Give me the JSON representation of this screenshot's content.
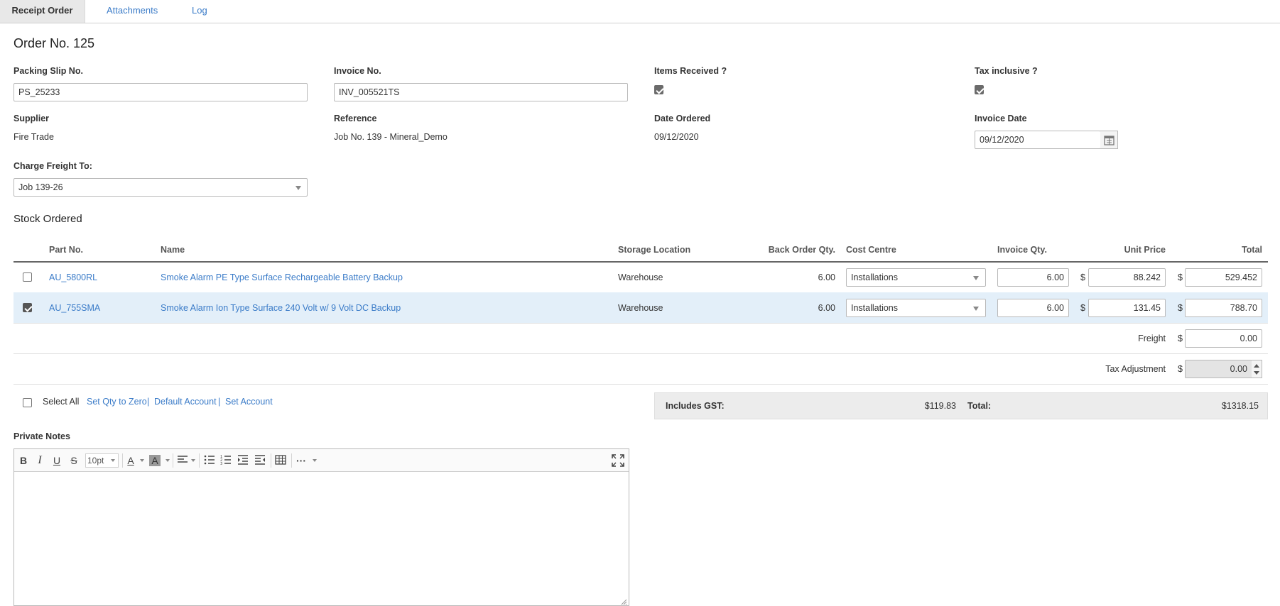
{
  "tabs": [
    {
      "label": "Receipt Order"
    },
    {
      "label": "Attachments"
    },
    {
      "label": "Log"
    }
  ],
  "page_title": "Order No. 125",
  "form": {
    "packing_slip_label": "Packing Slip No.",
    "packing_slip_value": "PS_25233",
    "invoice_no_label": "Invoice No.",
    "invoice_no_value": "INV_005521TS",
    "items_received_label": "Items Received ?",
    "tax_inclusive_label": "Tax inclusive ?",
    "supplier_label": "Supplier",
    "supplier_value": "Fire Trade",
    "reference_label": "Reference",
    "reference_value": "Job No. 139 - Mineral_Demo",
    "date_ordered_label": "Date Ordered",
    "date_ordered_value": "09/12/2020",
    "invoice_date_label": "Invoice Date",
    "invoice_date_value": "09/12/2020",
    "charge_freight_label": "Charge Freight To:",
    "charge_freight_value": "Job 139-26"
  },
  "stock": {
    "title": "Stock Ordered",
    "headers": {
      "part_no": "Part No.",
      "name": "Name",
      "storage": "Storage Location",
      "back_order": "Back Order Qty.",
      "cost_centre": "Cost Centre",
      "invoice_qty": "Invoice Qty.",
      "unit_price": "Unit Price",
      "total": "Total"
    },
    "currency": "$",
    "rows": [
      {
        "part_no": "AU_5800RL",
        "name": "Smoke Alarm PE Type Surface Rechargeable Battery Backup",
        "storage": "Warehouse",
        "back_order": "6.00",
        "cost_centre": "Installations",
        "invoice_qty": "6.00",
        "unit_price": "88.242",
        "total": "529.452",
        "checked": false
      },
      {
        "part_no": "AU_755SMA",
        "name": "Smoke Alarm Ion Type Surface 240 Volt w/ 9 Volt DC Backup",
        "storage": "Warehouse",
        "back_order": "6.00",
        "cost_centre": "Installations",
        "invoice_qty": "6.00",
        "unit_price": "131.45",
        "total": "788.70",
        "checked": true
      }
    ],
    "freight_label": "Freight",
    "freight_value": "0.00",
    "tax_adjustment_label": "Tax Adjustment",
    "tax_adjustment_value": "0.00"
  },
  "actions": {
    "select_all": "Select All",
    "set_qty_zero": "Set Qty to Zero",
    "separator": "|",
    "default_account": "Default Account",
    "set_account": "Set Account"
  },
  "summary": {
    "gst_label": "Includes GST:",
    "gst_value": "$119.83",
    "total_label": "Total:",
    "total_value": "$1318.15"
  },
  "notes": {
    "label": "Private Notes",
    "font_size": "10pt"
  }
}
